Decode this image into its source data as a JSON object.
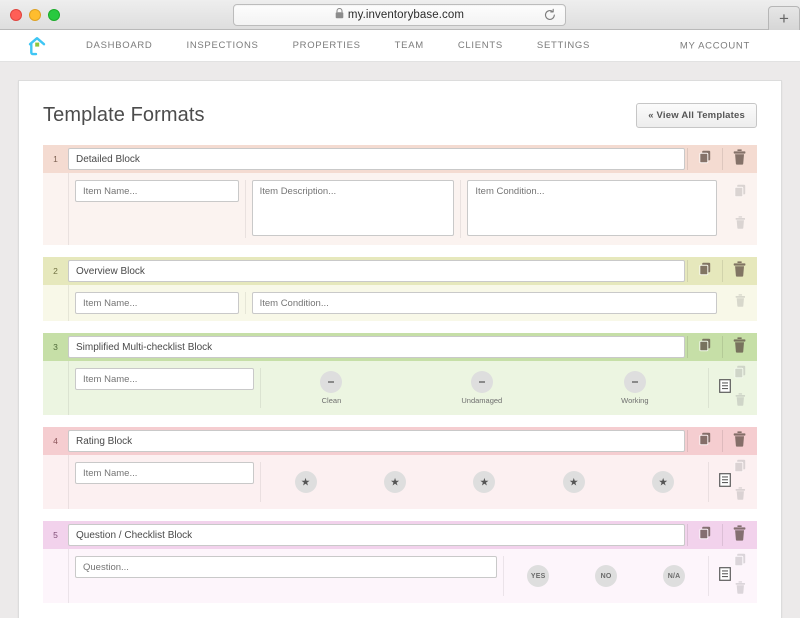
{
  "browser": {
    "url": "my.inventorybase.com",
    "lock_icon": "lock-icon",
    "reload_icon": "reload-icon",
    "new_tab_label": "+",
    "traffic_lights": [
      "close",
      "minimize",
      "maximize"
    ]
  },
  "nav": {
    "logo_icon": "inventorybase-house-logo",
    "items": [
      {
        "label": "DASHBOARD"
      },
      {
        "label": "INSPECTIONS"
      },
      {
        "label": "PROPERTIES"
      },
      {
        "label": "TEAM"
      },
      {
        "label": "CLIENTS"
      },
      {
        "label": "SETTINGS"
      }
    ],
    "account_label": "MY ACCOUNT"
  },
  "page": {
    "title": "Template Formats",
    "view_all_label": "« View All Templates"
  },
  "blocks": [
    {
      "number": "1",
      "title": "Detailed Block",
      "theme": "t-peach",
      "fields": [
        {
          "kind": "input",
          "placeholder": "Item Name..."
        },
        {
          "kind": "textarea",
          "placeholder": "Item Description..."
        },
        {
          "kind": "textarea",
          "placeholder": "Item Condition..."
        }
      ],
      "options": [],
      "has_note_icon": false,
      "side_icons": [
        "copy-icon",
        "trash-icon"
      ]
    },
    {
      "number": "2",
      "title": "Overview Block",
      "theme": "t-khaki",
      "fields": [
        {
          "kind": "input",
          "placeholder": "Item Name..."
        },
        {
          "kind": "input",
          "placeholder": "Item Condition..."
        }
      ],
      "options": [],
      "has_note_icon": false,
      "side_icons": [
        "trash-icon"
      ]
    },
    {
      "number": "3",
      "title": "Simplified Multi-checklist Block",
      "theme": "t-green",
      "fields": [
        {
          "kind": "input",
          "placeholder": "Item Name..."
        }
      ],
      "options": [
        {
          "glyph": "dash",
          "label": "Clean"
        },
        {
          "glyph": "dash",
          "label": "Undamaged"
        },
        {
          "glyph": "dash",
          "label": "Working"
        }
      ],
      "has_note_icon": true,
      "side_icons": [
        "copy-icon",
        "trash-icon"
      ]
    },
    {
      "number": "4",
      "title": "Rating Block",
      "theme": "t-pink",
      "fields": [
        {
          "kind": "input",
          "placeholder": "Item Name..."
        }
      ],
      "options": [
        {
          "glyph": "★",
          "label": ""
        },
        {
          "glyph": "★",
          "label": ""
        },
        {
          "glyph": "★",
          "label": ""
        },
        {
          "glyph": "★",
          "label": ""
        },
        {
          "glyph": "★",
          "label": ""
        }
      ],
      "has_note_icon": true,
      "side_icons": [
        "copy-icon",
        "trash-icon"
      ]
    },
    {
      "number": "5",
      "title": "Question / Checklist Block",
      "theme": "t-magenta",
      "fields": [
        {
          "kind": "input",
          "placeholder": "Question..."
        }
      ],
      "options": [
        {
          "glyph": "YES",
          "label": ""
        },
        {
          "glyph": "NO",
          "label": ""
        },
        {
          "glyph": "N/A",
          "label": ""
        }
      ],
      "has_note_icon": true,
      "side_icons": [
        "copy-icon",
        "trash-icon"
      ]
    }
  ],
  "colors": {
    "brand_cyan": "#3fc6f4",
    "brand_green": "#8dc63f",
    "peach_header": "#f4dbd1",
    "khaki_header": "#e6e8bc",
    "green_header": "#c6dfa7",
    "pink_header": "#f5cdd0",
    "magenta_header": "#f2d2ec"
  }
}
